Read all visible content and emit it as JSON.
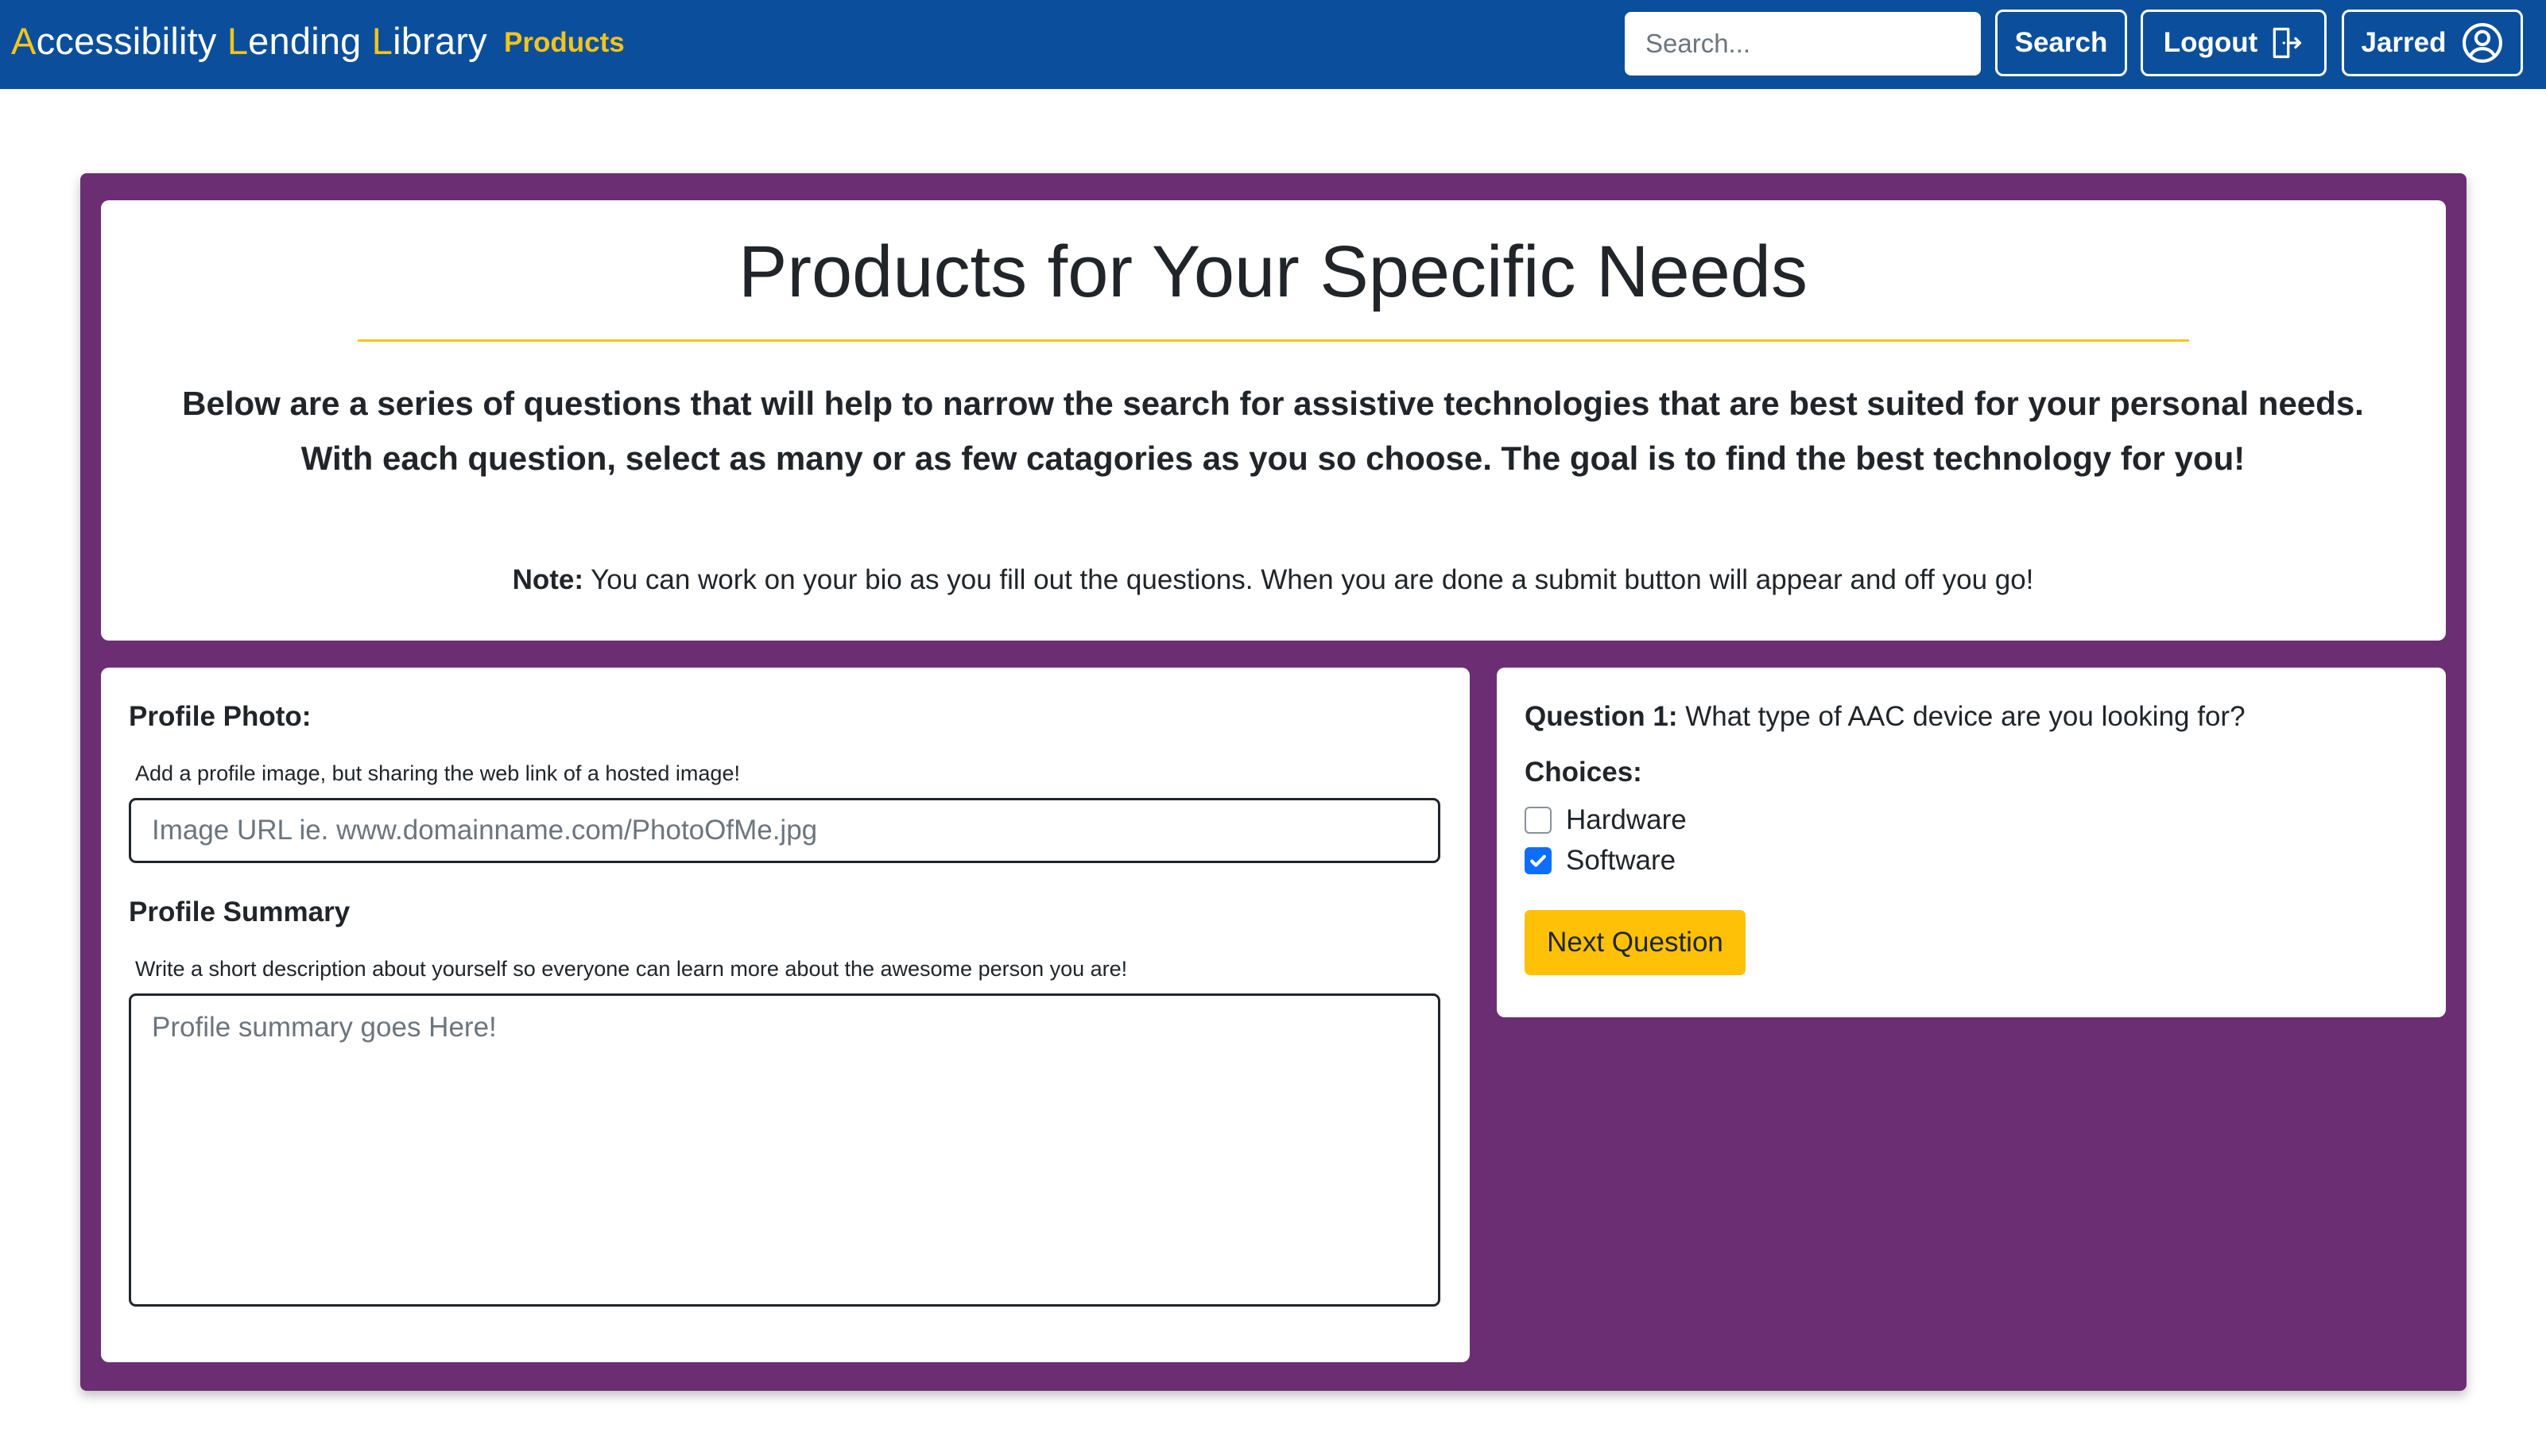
{
  "colors": {
    "navbar": "#0b4f9c",
    "brand_accent": "#f6c41a",
    "main_panel": "#6b2e73",
    "primary_button": "#ffc107",
    "checkbox_checked": "#0d6efd"
  },
  "navbar": {
    "brand": {
      "p1": "A",
      "p2": "ccessibility ",
      "p3": "L",
      "p4": "ending ",
      "p5": "L",
      "p6": "ibrary"
    },
    "products_link": "Products",
    "search": {
      "placeholder": "Search...",
      "value": ""
    },
    "search_button": "Search",
    "logout_button": "Logout",
    "logout_icon": "door-exit-icon",
    "user_button": "Jarred",
    "user_icon": "user-circle-icon"
  },
  "header": {
    "title": "Products for Your Specific Needs",
    "intro_line1": "Below are a series of questions that will help to narrow the search for assistive technologies that are best suited for your personal needs.",
    "intro_line2": "With each question, select as many or as few catagories as you so choose. The goal is to find the best technology for you!",
    "note_label": "Note:",
    "note_text": " You can work on your bio as you fill out the questions. When you are done a submit button will appear and off you go!"
  },
  "profile": {
    "photo_label": "Profile Photo:",
    "photo_help": "Add a profile image, but sharing the web link of a hosted image!",
    "photo_placeholder": "Image URL ie. www.domainname.com/PhotoOfMe.jpg",
    "photo_value": "",
    "summary_label": "Profile Summary",
    "summary_help": "Write a short description about yourself so everyone can learn more about the awesome person you are!",
    "summary_placeholder": "Profile summary goes Here!",
    "summary_value": ""
  },
  "question": {
    "number_label": "Question 1:",
    "text": " What type of AAC device are you looking for?",
    "choices_label": "Choices:",
    "choices": [
      {
        "label": "Hardware",
        "checked": false
      },
      {
        "label": "Software",
        "checked": true
      }
    ],
    "next_button": "Next Question"
  }
}
